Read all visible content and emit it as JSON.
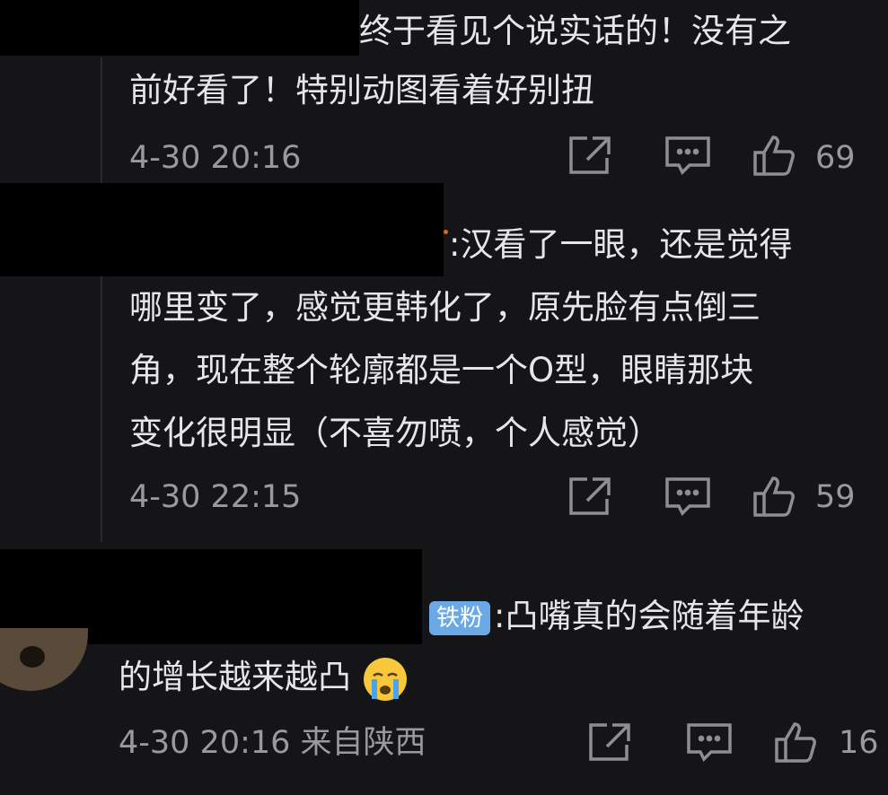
{
  "comments": [
    {
      "lines": [
        "终于看见个说实话的！没有之",
        "前好看了！特别动图看着好别扭"
      ],
      "meta": "4-30 20:16",
      "likes": "69"
    },
    {
      "lines": [
        ":汉看了一眼，还是觉得",
        "哪里变了，感觉更韩化了，原先脸有点倒三",
        "角，现在整个轮廓都是一个O型，眼睛那块",
        "变化很明显（不喜勿喷，个人感觉）"
      ],
      "meta": "4-30 22:15",
      "likes": "59"
    },
    {
      "badge": "铁粉",
      "lines": [
        ":凸嘴真的会随着年龄",
        "的增长越来越凸"
      ],
      "meta": "4-30 20:16 来自陕西",
      "likes": "16"
    }
  ]
}
